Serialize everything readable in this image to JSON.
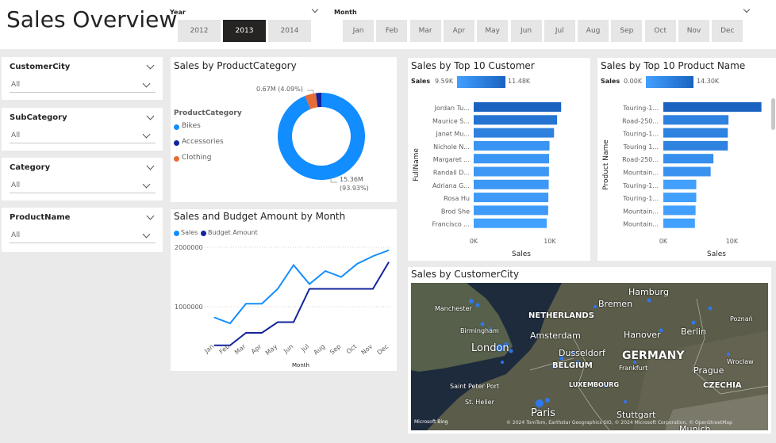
{
  "header": {
    "title": "Sales Overview",
    "year_label": "Year",
    "years": [
      {
        "label": "2012",
        "active": false
      },
      {
        "label": "2013",
        "active": true
      },
      {
        "label": "2014",
        "active": false
      }
    ],
    "month_label": "Month",
    "months": [
      "Jan",
      "Feb",
      "Mar",
      "Apr",
      "May",
      "Jun",
      "Jul",
      "Aug",
      "Sep",
      "Oct",
      "Nov",
      "Dec"
    ]
  },
  "filters": [
    {
      "label": "CustomerCity",
      "value": "All"
    },
    {
      "label": "SubCategory",
      "value": "All"
    },
    {
      "label": "Category",
      "value": "All"
    },
    {
      "label": "ProductName",
      "value": "All"
    }
  ],
  "donut": {
    "title": "Sales by ProductCategory",
    "legend_title": "ProductCategory",
    "label_small": "0.67M (4.09%)",
    "label_big_1": "15.36M",
    "label_big_2": "(93.93%)"
  },
  "line_chart_text": {
    "title": "Sales and Budget Amount by Month",
    "xlabel": "Month",
    "y_ticks": [
      "2000000",
      "1000000"
    ]
  },
  "customer_chart_text": {
    "title": "Sales by Top 10 Customer",
    "scale_label": "Sales",
    "scale_min": "9.59K",
    "scale_max": "11.48K",
    "ylabel": "FullName",
    "xlabel": "Sales",
    "x_ticks": [
      "0K",
      "10K"
    ]
  },
  "product_chart_text": {
    "title": "Sales by Top 10 Product Name",
    "scale_label": "Sales",
    "scale_min": "0.00K",
    "scale_max": "14.30K",
    "ylabel": "Product Name",
    "xlabel": "Sales",
    "x_ticks": [
      "0K",
      "10K"
    ]
  },
  "map": {
    "title": "Sales by CustomerCity",
    "cities": [
      {
        "name": "Manchester",
        "style": "small"
      },
      {
        "name": "Birmingham",
        "style": "small"
      },
      {
        "name": "London",
        "style": "large"
      },
      {
        "name": "NETHERLANDS",
        "style": "country"
      },
      {
        "name": "Amsterdam",
        "style": "medium"
      },
      {
        "name": "Bremen",
        "style": "medium"
      },
      {
        "name": "Hamburg",
        "style": "medium"
      },
      {
        "name": "Hanover",
        "style": "medium"
      },
      {
        "name": "Berlin",
        "style": "medium"
      },
      {
        "name": "Poznań",
        "style": "small"
      },
      {
        "name": "Dusseldorf",
        "style": "medium"
      },
      {
        "name": "GERMANY",
        "style": "country-big"
      },
      {
        "name": "BELGIUM",
        "style": "country"
      },
      {
        "name": "Frankfurt",
        "style": "small"
      },
      {
        "name": "Prague",
        "style": "medium"
      },
      {
        "name": "Wrocław",
        "style": "small"
      },
      {
        "name": "LUXEMBOURG",
        "style": "country-small"
      },
      {
        "name": "CZECHIA",
        "style": "country"
      },
      {
        "name": "Saint Peter Port",
        "style": "small"
      },
      {
        "name": "St. Helier",
        "style": "small"
      },
      {
        "name": "Paris",
        "style": "large"
      },
      {
        "name": "Stuttgart",
        "style": "medium"
      },
      {
        "name": "Munich",
        "style": "medium"
      }
    ],
    "bing_label": "Microsoft Bing",
    "copyright": "© 2024 TomTom, Earthstar Geographics SIO, © 2024 Microsoft Corporation, © OpenStreetMap"
  },
  "chart_data": [
    {
      "type": "pie",
      "title": "Sales by ProductCategory",
      "categories": [
        "Bikes",
        "Accessories",
        "Clothing"
      ],
      "values": [
        15.36,
        0.33,
        0.67
      ],
      "units": "M",
      "percent": [
        93.93,
        1.98,
        4.09
      ],
      "colors": [
        "#118DFF",
        "#12239E",
        "#E66C37"
      ],
      "legend": "left"
    },
    {
      "type": "line",
      "title": "Sales and Budget Amount by Month",
      "xlabel": "Month",
      "categories": [
        "Jan",
        "Feb",
        "Mar",
        "Apr",
        "May",
        "Jun",
        "Jul",
        "Aug",
        "Sep",
        "Oct",
        "Nov",
        "Dec"
      ],
      "series": [
        {
          "name": "Sales",
          "color": "#118DFF",
          "values": [
            820000,
            720000,
            1050000,
            1050000,
            1300000,
            1700000,
            1380000,
            1600000,
            1500000,
            1720000,
            1850000,
            1950000
          ]
        },
        {
          "name": "Budget Amount",
          "color": "#12239E",
          "values": [
            350000,
            350000,
            560000,
            560000,
            740000,
            740000,
            1300000,
            1300000,
            1300000,
            1300000,
            1300000,
            1750000
          ]
        }
      ],
      "ylim": [
        0,
        2000000
      ],
      "legend": "top-left",
      "grid": true
    },
    {
      "type": "bar",
      "orientation": "horizontal",
      "title": "Sales by Top 10 Customer",
      "categories": [
        "Jordan Tu...",
        "Maurice S...",
        "Janet Mu...",
        "Nichole N...",
        "Margaret ...",
        "Randall D...",
        "Adriana G...",
        "Rosa Hu",
        "Brod She",
        "Francisco ..."
      ],
      "values": [
        11480,
        10950,
        10550,
        9950,
        9900,
        9880,
        9850,
        9800,
        9780,
        9590
      ],
      "xlim": [
        0,
        12500
      ],
      "ylabel": "FullName",
      "xlabel": "Sales",
      "color_range": [
        "#42A0FF",
        "#1A63C0"
      ]
    },
    {
      "type": "bar",
      "orientation": "horizontal",
      "title": "Sales by Top 10 Product Name",
      "categories": [
        "Touring-1...",
        "Road-250...",
        "Touring-1...",
        "Touring 1...",
        "Road-250...",
        "Mountain...",
        "Touring-1...",
        "Touring-1...",
        "Mountain...",
        "Mountain..."
      ],
      "values": [
        14300,
        9500,
        9400,
        9400,
        7300,
        6900,
        4800,
        4800,
        4700,
        4600
      ],
      "xlim": [
        0,
        15500
      ],
      "ylabel": "Product Name",
      "xlabel": "Sales",
      "color_range": [
        "#42A0FF",
        "#1A63C0"
      ]
    }
  ]
}
